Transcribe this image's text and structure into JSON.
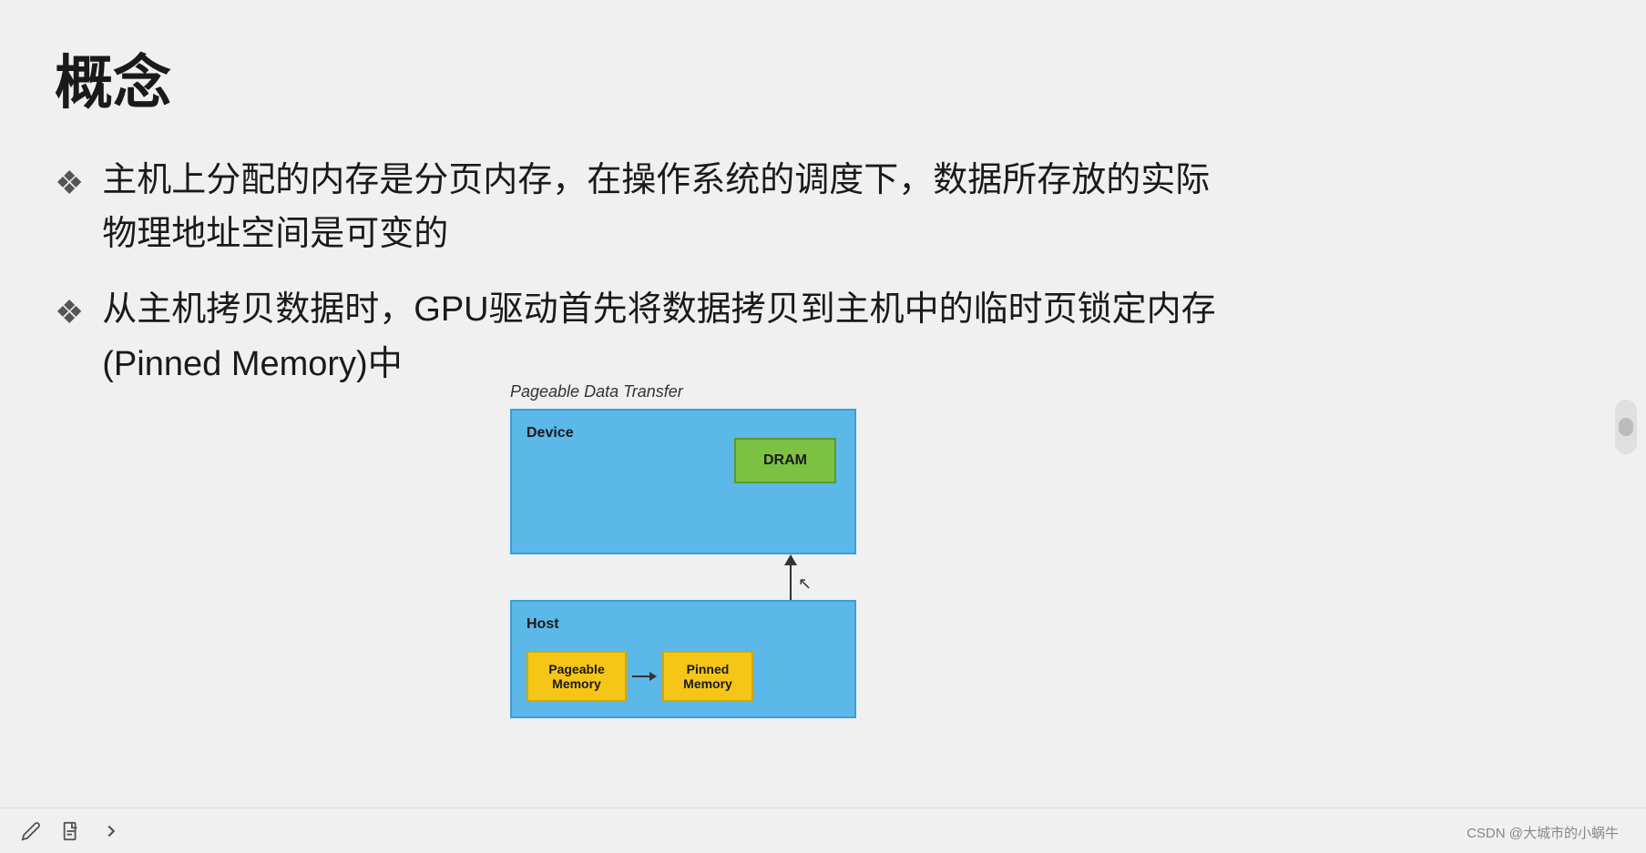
{
  "slide": {
    "title": "概念",
    "bullets": [
      {
        "id": 1,
        "line1": "主机上分配的内存是分页内存，在操作系统的调度下，数据所存放的实际",
        "line2": "物理地址空间是可变的"
      },
      {
        "id": 2,
        "line1": "从主机拷贝数据时，GPU驱动首先将数据拷贝到主机中的临时页锁定内存",
        "line2": "(Pinned Memory)中"
      }
    ],
    "diagram": {
      "title": "Pageable Data Transfer",
      "device_label": "Device",
      "host_label": "Host",
      "dram_label": "DRAM",
      "pageable_label": "Pageable\nMemory",
      "pinned_label": "Pinned\nMemory"
    }
  },
  "bottom": {
    "icons": [
      "pencil-icon",
      "document-icon",
      "arrow-icon"
    ],
    "watermark": "CSDN @大城市的小蜗牛"
  }
}
